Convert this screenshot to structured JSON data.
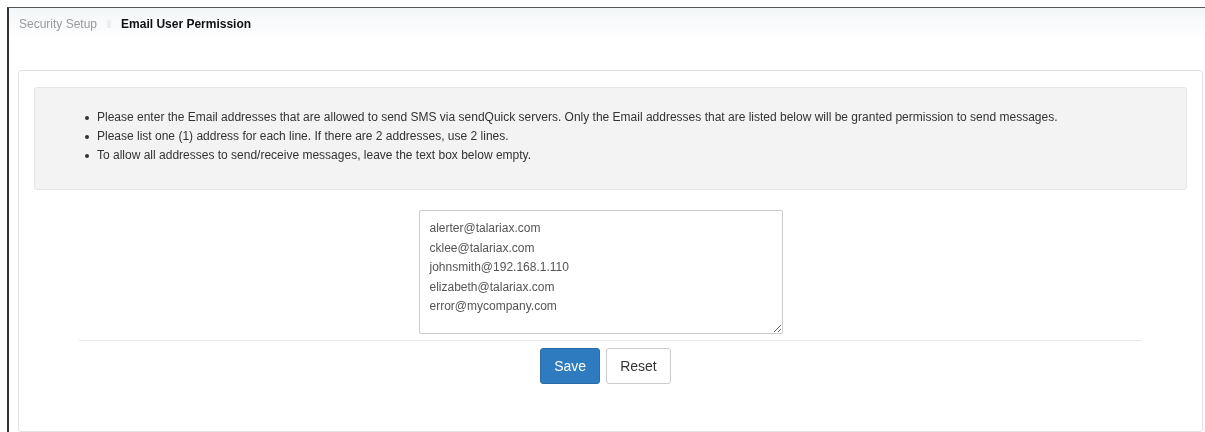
{
  "breadcrumb": [
    {
      "label": "Security Setup",
      "current": false
    },
    {
      "label": "Email User Permission",
      "current": true
    }
  ],
  "instructions": [
    "Please enter the Email addresses that are allowed to send SMS via sendQuick servers. Only the Email addresses that are listed below will be granted permission to send messages.",
    "Please list one (1) address for each line. If there are 2 addresses, use 2 lines.",
    "To allow all addresses to send/receive messages, leave the text box below empty."
  ],
  "addresses": [
    "alerter@talariax.com",
    "cklee@talariax.com",
    "johnsmith@192.168.1.110",
    "elizabeth@talariax.com",
    "error@mycompany.com"
  ],
  "buttons": [
    {
      "label": "Save",
      "kind": "primary"
    },
    {
      "label": "Reset",
      "kind": "default"
    }
  ]
}
